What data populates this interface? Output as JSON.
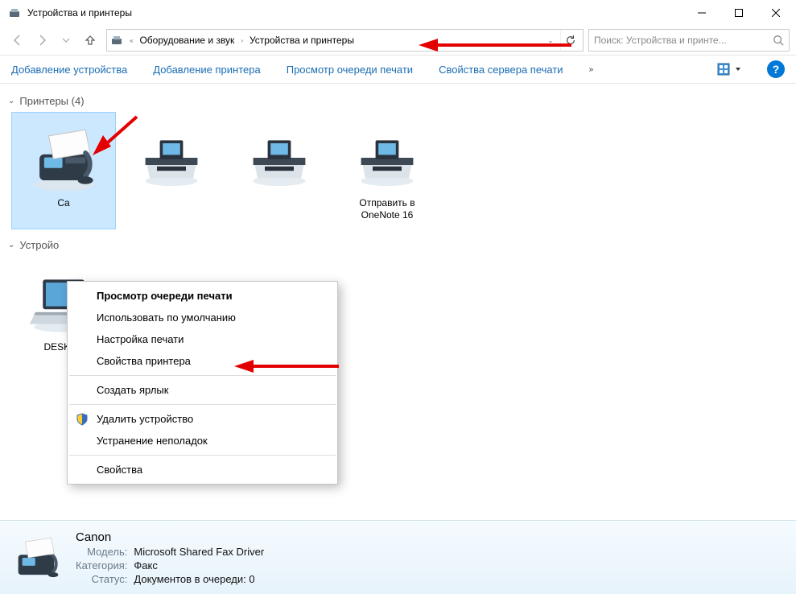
{
  "window": {
    "title": "Устройства и принтеры"
  },
  "breadcrumb": {
    "seg1": "Оборудование и звук",
    "seg2": "Устройства и принтеры"
  },
  "search": {
    "placeholder": "Поиск: Устройства и принте..."
  },
  "toolbar": {
    "add_device": "Добавление устройства",
    "add_printer": "Добавление принтера",
    "view_queue": "Просмотр очереди печати",
    "server_props": "Свойства сервера печати"
  },
  "groups": {
    "printers": {
      "label": "Принтеры (4)"
    },
    "devices": {
      "label": "Устройо"
    }
  },
  "printers": [
    {
      "name": "Ca"
    },
    {
      "name": ""
    },
    {
      "name": ""
    },
    {
      "name": "Отправить в OneNote 16"
    }
  ],
  "devices": [
    {
      "name": "DESKTO"
    }
  ],
  "context_menu": {
    "view_queue": "Просмотр очереди печати",
    "set_default": "Использовать по умолчанию",
    "print_setup": "Настройка печати",
    "printer_props": "Свойства принтера",
    "create_shortcut": "Создать ярлык",
    "remove_device": "Удалить устройство",
    "troubleshoot": "Устранение неполадок",
    "properties": "Свойства"
  },
  "details": {
    "title": "Canon",
    "model_label": "Модель:",
    "model_value": "Microsoft Shared Fax Driver",
    "category_label": "Категория:",
    "category_value": "Факс",
    "status_label": "Статус:",
    "status_value": "Документов в очереди: 0"
  }
}
